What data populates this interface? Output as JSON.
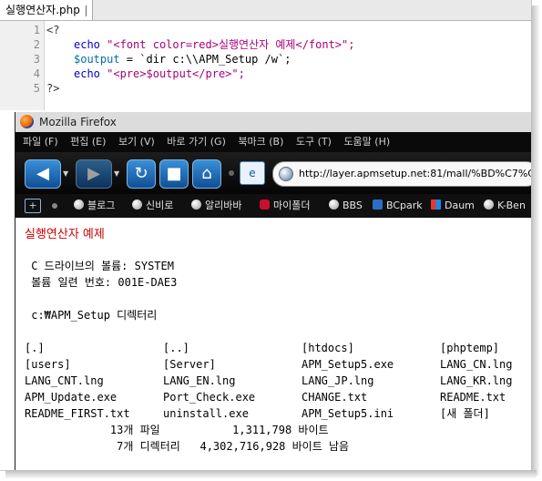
{
  "editor": {
    "tab_label": "실행연산자.php",
    "line_numbers": [
      "1",
      "2",
      "3",
      "4",
      "5"
    ],
    "lines": {
      "l1": "<?",
      "l2_kw": "echo",
      "l2_str": "\"<font color=red>실행연산자 예제</font>\";",
      "l3_var": "$output",
      "l3_rest": " = `dir c:\\\\APM_Setup /w`;",
      "l4_kw": "echo",
      "l4_str": "\"<pre>$output</pre>\";",
      "l5": "?>"
    }
  },
  "browser": {
    "title": "Mozilla Firefox",
    "menu": [
      "파일 (F)",
      "편집 (E)",
      "보기 (V)",
      "바로 가기 (G)",
      "북마크 (B)",
      "도구 (T)",
      "도움말 (H)"
    ],
    "url": "http://layer.apmsetup.net:81/mall/%BD%C7%C7%",
    "bookmarks": [
      "블로그",
      "신비로",
      "알리바바",
      "마이폴더",
      "BBS",
      "BCpark",
      "Daum",
      "K-Ben"
    ]
  },
  "page": {
    "heading": "실행연산자 예제",
    "volume_line": " C 드라이브의 볼륨: SYSTEM",
    "serial_line": " 볼륨 일련 번호: 001E-DAE3",
    "dir_line": " c:₩APM_Setup 디렉터리",
    "listing": [
      [
        "[.]",
        "[..]",
        "[htdocs]",
        "[phptemp]"
      ],
      [
        "[users]",
        "[Server]",
        "APM_Setup5.exe",
        "LANG_CN.lng"
      ],
      [
        "LANG_CNT.lng",
        "LANG_EN.lng",
        "LANG_JP.lng",
        "LANG_KR.lng"
      ],
      [
        "APM_Update.exe",
        "Port_Check.exe",
        "CHANGE.txt",
        "README.txt"
      ],
      [
        "README_FIRST.txt",
        "uninstall.exe",
        "APM_Setup5.ini",
        "[새 폴더]"
      ]
    ],
    "summary_files": "             13개 파일           1,311,798 바이트",
    "summary_dirs": "              7개 디렉터리   4,302,716,928 바이트 남음"
  }
}
